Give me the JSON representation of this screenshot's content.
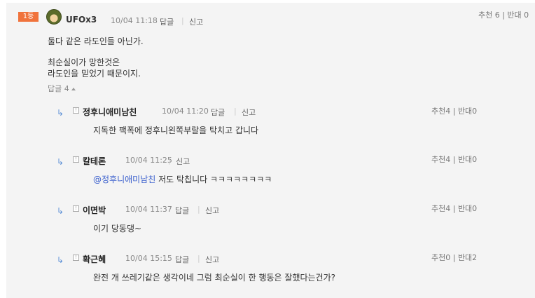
{
  "comment": {
    "rank": "1등",
    "user": "UFOx3",
    "time": "10/04 11:18",
    "reply_label": "답글",
    "report_label": "신고",
    "votes": "추천 6 | 반대 0",
    "line1": "둘다 같은 라도인들 아닌가.",
    "line2": "최순실이가 망한것은",
    "line3": "라도인을 믿었기 때문이지.",
    "replies_toggle": "답글",
    "replies_count": "4"
  },
  "replies": [
    {
      "user": "정후니애미남친",
      "time": "10/04 11:20",
      "reply_label": "답글",
      "report_label": "신고",
      "votes": "추천4 | 반대0",
      "mention": "",
      "text": "지독한 팩폭에 정후니왼쪽부랄을 탁치고 갑니다"
    },
    {
      "user": "칼테론",
      "time": "10/04 11:25",
      "reply_label": "",
      "report_label": "신고",
      "votes": "추천4 | 반대0",
      "mention": "@정후니애미남친",
      "text": "저도 탁칩니다 ㅋㅋㅋㅋㅋㅋㅋㅋ"
    },
    {
      "user": "이면박",
      "time": "10/04 11:37",
      "reply_label": "답글",
      "report_label": "신고",
      "votes": "추천4 | 반대0",
      "mention": "",
      "text": "이기 당동댕~"
    },
    {
      "user": "확근혜",
      "time": "10/04 15:15",
      "reply_label": "답글",
      "report_label": "신고",
      "votes": "추천0 | 반대2",
      "mention": "",
      "text": "완전 개 쓰레기같은 생각이네 그럼 최순실이 한 행동은 잘했다는건가?"
    }
  ],
  "icons": {
    "reply_arrow": "reply-arrow-icon",
    "report": "report-icon",
    "avatar": "avatar-icon"
  }
}
